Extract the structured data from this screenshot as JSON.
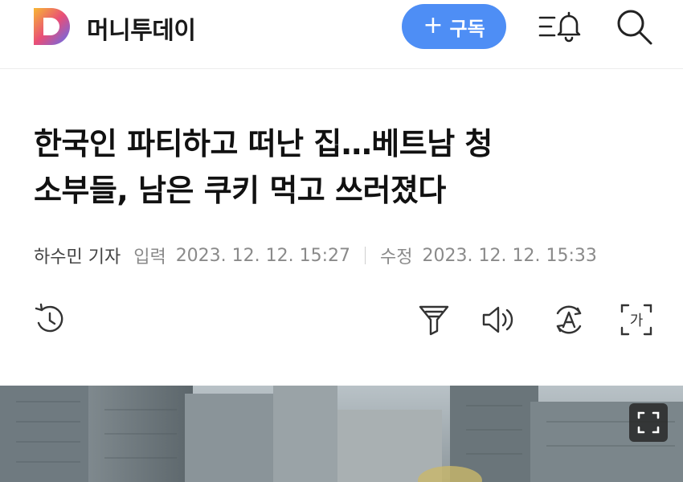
{
  "header": {
    "logo_letter": "D",
    "brand": "머니투데이",
    "subscribe_label": "구독",
    "accent": "#4e8ef5"
  },
  "article": {
    "headline_line1": "한국인 파티하고 떠난 집…베트남 청",
    "headline_line2": "소부들, 남은 쿠키 먹고 쓰러졌다",
    "reporter": "하수민 기자",
    "published_label": "입력",
    "published": "2023. 12. 12. 15:27",
    "modified_label": "수정",
    "modified": "2023. 12. 12. 15:33"
  },
  "toolbar": {
    "icons": [
      "history-icon",
      "filter-icon",
      "speaker-icon",
      "translate-icon",
      "font-size-icon"
    ],
    "font_size_glyph": "가"
  },
  "hero": {
    "icon": "expand-icon"
  }
}
